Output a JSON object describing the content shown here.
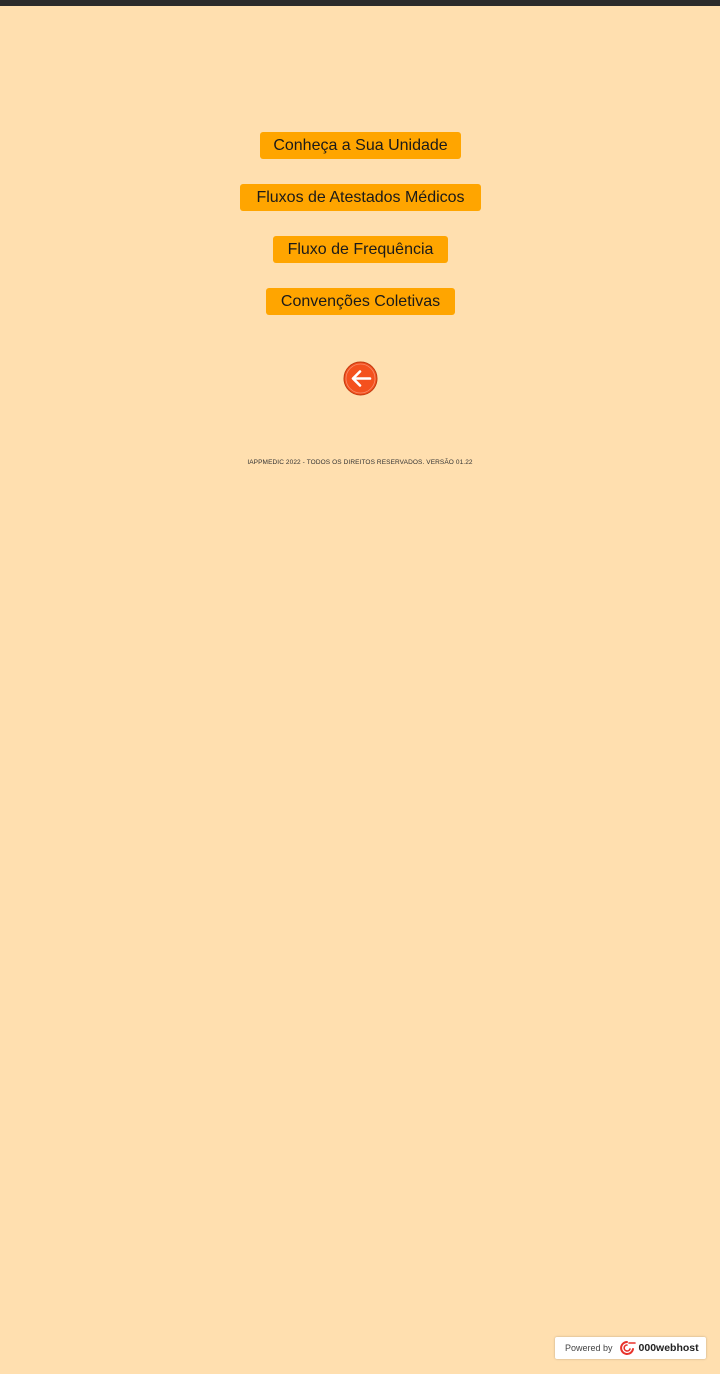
{
  "menu": {
    "items": [
      {
        "label": "Conheça a Sua Unidade"
      },
      {
        "label": "Fluxos de Atestados Médicos"
      },
      {
        "label": "Fluxo de Frequência"
      },
      {
        "label": "Convenções Coletivas"
      }
    ]
  },
  "back_button": {
    "icon": "arrow-left-icon"
  },
  "footer": {
    "text": "IAPPMEDIC 2022 - TODOS OS DIREITOS RESERVADOS. VERSÃO 01.22"
  },
  "badge": {
    "powered_by": "Powered by",
    "brand": "000webhost",
    "icon": "000webhost-logo-icon"
  },
  "colors": {
    "background": "#FFDFAF",
    "button": "#FFA500",
    "back_button": "#F4511E",
    "top_bar": "#2b2b2b"
  }
}
